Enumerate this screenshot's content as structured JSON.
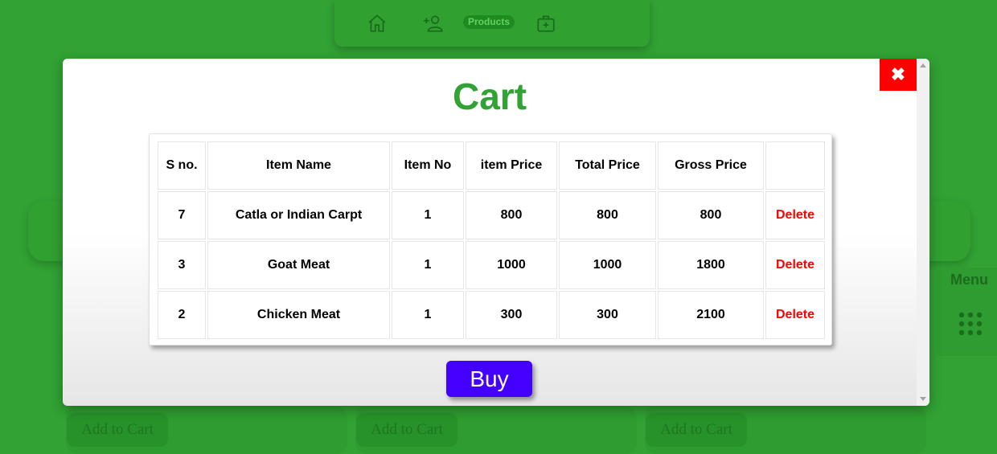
{
  "nav": {
    "products_label": "Products",
    "icons": [
      "home-icon",
      "add-user-icon",
      "products-pill",
      "medical-bag-icon"
    ]
  },
  "background": {
    "menu_label": "Menu",
    "add_to_cart_label": "Add to Cart"
  },
  "modal": {
    "title": "Cart",
    "close_icon": "close-x-icon",
    "columns": [
      "S no.",
      "Item Name",
      "Item No",
      "item Price",
      "Total Price",
      "Gross Price",
      ""
    ],
    "rows": [
      {
        "sno": "7",
        "name": "Catla or Indian Carpt",
        "item_no": "1",
        "item_price": "800",
        "total_price": "800",
        "gross_price": "800",
        "action": "Delete"
      },
      {
        "sno": "3",
        "name": "Goat Meat",
        "item_no": "1",
        "item_price": "1000",
        "total_price": "1000",
        "gross_price": "1800",
        "action": "Delete"
      },
      {
        "sno": "2",
        "name": "Chicken Meat",
        "item_no": "1",
        "item_price": "300",
        "total_price": "300",
        "gross_price": "2100",
        "action": "Delete"
      }
    ],
    "buy_label": "Buy"
  },
  "colors": {
    "background": "#31a233",
    "title": "#31a233",
    "close": "#ff0000",
    "delete": "#ff0000",
    "buy": "#4400ff"
  }
}
